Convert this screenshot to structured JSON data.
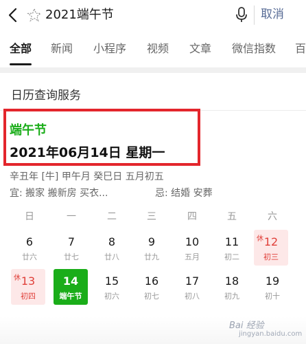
{
  "search": {
    "query": "2021端午节",
    "cancel_label": "取消"
  },
  "tabs": [
    {
      "label": "全部",
      "active": true
    },
    {
      "label": "新闻"
    },
    {
      "label": "小程序"
    },
    {
      "label": "视频"
    },
    {
      "label": "文章"
    },
    {
      "label": "微信指数"
    },
    {
      "label": "百"
    }
  ],
  "section_title": "日历查询服务",
  "festival": {
    "name": "端午节",
    "date_text": "2021年06月14日 星期一"
  },
  "lunar_text": "辛丑年 [牛] 甲午月 癸巳日 五月初五",
  "yi_text": "宜: 搬家 搬新房 买衣...",
  "ji_text": "忌: 结婚 安葬",
  "calendar": {
    "weekdays": [
      "日",
      "一",
      "二",
      "三",
      "四",
      "五",
      "六"
    ],
    "rows": [
      [
        {
          "num": "6",
          "sub": "廿六"
        },
        {
          "num": "7",
          "sub": "廿七"
        },
        {
          "num": "8",
          "sub": "廿八"
        },
        {
          "num": "9",
          "sub": "廿九"
        },
        {
          "num": "10",
          "sub": "五月"
        },
        {
          "num": "11",
          "sub": "初二"
        },
        {
          "num": "12",
          "sub": "初三",
          "badge": "休"
        }
      ],
      [
        {
          "num": "13",
          "sub": "初四",
          "badge": "休"
        },
        {
          "num": "14",
          "sub": "端午节"
        },
        {
          "num": "15",
          "sub": "初六"
        },
        {
          "num": "16",
          "sub": "初七"
        },
        {
          "num": "17",
          "sub": "初八"
        },
        {
          "num": "18",
          "sub": "初九"
        },
        {
          "num": "19",
          "sub": "初十"
        }
      ]
    ]
  },
  "watermark": {
    "text": "Bai 经验",
    "sub": "jingyan.baidu.com"
  },
  "colors": {
    "accent_green": "#1aad19",
    "highlight_red": "#e3262c",
    "holiday_red": "#e0403a",
    "link_blue": "#576b95"
  }
}
